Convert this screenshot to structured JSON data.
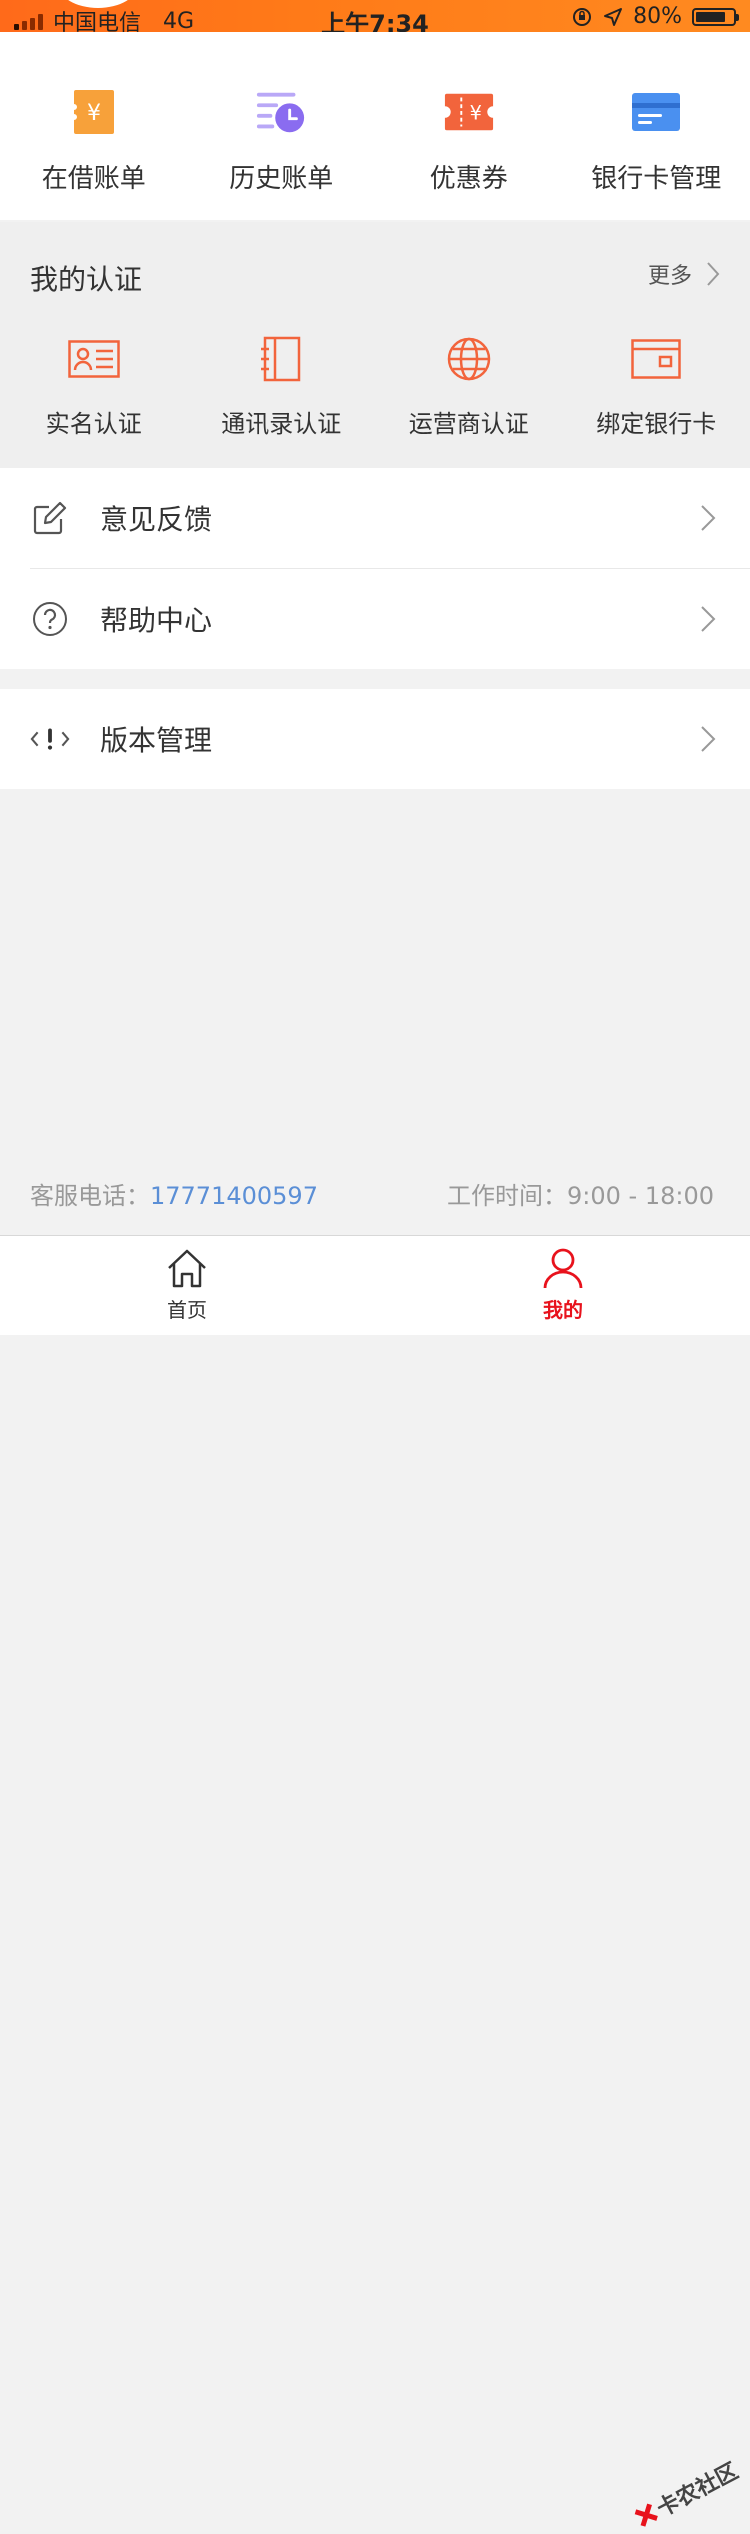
{
  "status_bar": {
    "carrier": "中国电信",
    "network": "4G",
    "time": "上午7:34",
    "battery": "80%",
    "battery_level": 0.8
  },
  "quick_actions": [
    {
      "label": "在借账单",
      "icon": "yen-ticket-icon"
    },
    {
      "label": "历史账单",
      "icon": "history-clock-icon"
    },
    {
      "label": "优惠券",
      "icon": "coupon-icon"
    },
    {
      "label": "银行卡管理",
      "icon": "bank-card-icon"
    }
  ],
  "certification": {
    "title": "我的认证",
    "more": "更多",
    "items": [
      {
        "label": "实名认证",
        "icon": "id-card-icon"
      },
      {
        "label": "通讯录认证",
        "icon": "address-book-icon"
      },
      {
        "label": "运营商认证",
        "icon": "globe-icon"
      },
      {
        "label": "绑定银行卡",
        "icon": "wallet-icon"
      }
    ]
  },
  "menu_group1": [
    {
      "label": "意见反馈",
      "icon": "edit-icon"
    },
    {
      "label": "帮助中心",
      "icon": "help-circle-icon"
    }
  ],
  "menu_group2": [
    {
      "label": "版本管理",
      "icon": "code-alert-icon"
    }
  ],
  "footer": {
    "hotline_label": "客服电话：",
    "hotline_number": "17771400597",
    "hours": "工作时间：9:00 - 18:00"
  },
  "tabbar": {
    "home": "首页",
    "mine": "我的"
  },
  "watermark": "卡农社区",
  "colors": {
    "orange": "#ff6a2b",
    "accent_red": "#e8121c",
    "link_blue": "#5b8fd6",
    "purple": "#8a6cf0",
    "blue": "#4a90f0"
  }
}
